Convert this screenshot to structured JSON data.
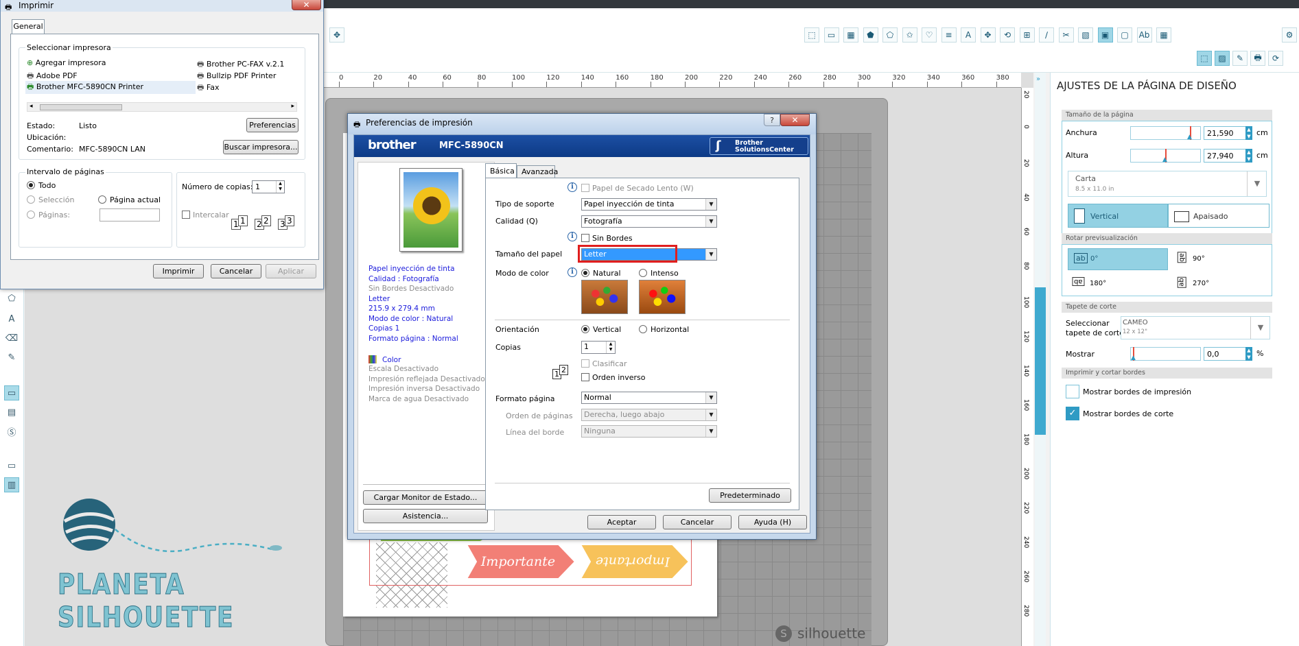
{
  "app": {
    "tool_icons": [
      "select-icon",
      "rectangle-icon",
      "grid-icon",
      "pentagon-icon",
      "star-icon",
      "shape-icon",
      "heart-icon",
      "lines-icon",
      "text-icon",
      "replicate-icon",
      "rotate-icon",
      "scale-icon",
      "knife-icon",
      "trace-icon",
      "page-icon",
      "cut-settings-icon",
      "layout-icon",
      "text-style-icon",
      "grid-settings-icon"
    ],
    "panel": {
      "title": "AJUSTES DE LA PÁGINA DE DISEÑO",
      "size_header": "Tamaño de la página",
      "width_label": "Anchura",
      "width_value": "21,590",
      "height_label": "Altura",
      "height_value": "27,940",
      "unit": "cm",
      "paper_name": "Carta",
      "paper_size": "8.5 x 11.0 in",
      "portrait": "Vertical",
      "landscape": "Apaisado",
      "rotate_header": "Rotar previsualización",
      "rot0": "0°",
      "rot90": "90°",
      "rot180": "180°",
      "rot270": "270°",
      "mat_header": "Tapete de corte",
      "mat_label_1": "Seleccionar",
      "mat_label_2": "tapete de corte",
      "mat_name": "CAMEO",
      "mat_size": "12 x 12\"",
      "show_label": "Mostrar",
      "show_value": "0,0",
      "show_unit": "%",
      "borders_header": "Imprimir y cortar bordes",
      "print_borders": "Mostrar bordes de impresión",
      "cut_borders": "Mostrar bordes de corte"
    },
    "ruler_top": [
      "0",
      "20",
      "40",
      "60",
      "80",
      "100",
      "120",
      "140",
      "160",
      "180",
      "200",
      "220",
      "240",
      "260",
      "280",
      "300",
      "320",
      "340",
      "360",
      "380"
    ],
    "ruler_right": [
      "20",
      "0",
      "20",
      "40",
      "60",
      "80",
      "100",
      "120",
      "140",
      "160",
      "180",
      "200",
      "220",
      "240",
      "260",
      "280"
    ],
    "brand": "silhouette",
    "logo_text": "PLANETA SILHOUETTE",
    "label_1": "Importante",
    "label_2": "Importante"
  },
  "print_dialog": {
    "title": "Imprimir",
    "tab": "General",
    "select_printer": "Seleccionar impresora",
    "printers": [
      "Agregar impresora",
      "Adobe PDF",
      "Brother MFC-5890CN Printer",
      "Brother PC-FAX v.2.1",
      "Bullzip PDF Printer",
      "Fax"
    ],
    "status_label": "Estado:",
    "status_value": "Listo",
    "location_label": "Ubicación:",
    "comment_label": "Comentario:",
    "comment_value": "MFC-5890CN LAN",
    "preferences_btn": "Preferencias",
    "find_printer_btn": "Buscar impresora...",
    "range_title": "Intervalo de páginas",
    "all": "Todo",
    "selection": "Selección",
    "current_page": "Página actual",
    "pages": "Páginas:",
    "copies_label": "Número de copias:",
    "copies_value": "1",
    "collate": "Intercalar",
    "print_btn": "Imprimir",
    "cancel_btn": "Cancelar",
    "apply_btn": "Aplicar"
  },
  "prefs_dialog": {
    "title": "Preferencias de impresión",
    "brand": "brother",
    "model": "MFC-5890CN",
    "solutions_1": "Brother",
    "solutions_2": "SolutionsCenter",
    "tab_basic": "Básica",
    "tab_advanced": "Avanzada",
    "slow_drying": "Papel de Secado Lento (W)",
    "media_type_label": "Tipo de soporte",
    "media_type_value": "Papel inyección de tinta",
    "quality_label": "Calidad (Q)",
    "quality_value": "Fotografía",
    "borderless": "Sin Bordes",
    "paper_size_label": "Tamaño del papel",
    "paper_size_value": "Letter",
    "color_mode_label": "Modo de color",
    "natural": "Natural",
    "vivid": "Intenso",
    "orientation_label": "Orientación",
    "portrait": "Vertical",
    "landscape": "Horizontal",
    "copies_label": "Copias",
    "copies_value": "1",
    "collate": "Clasificar",
    "reverse": "Orden inverso",
    "page_layout_label": "Formato página",
    "page_layout_value": "Normal",
    "page_order_label": "Orden de páginas",
    "page_order_value": "Derecha, luego abajo",
    "border_line_label": "Línea del borde",
    "border_line_value": "Ninguna",
    "default_btn": "Predeterminado",
    "info_lines": [
      "Papel inyección de tinta",
      "Calidad  : Fotografía",
      "Sin Bordes Desactivado",
      "Letter",
      "215.9 x 279.4 mm",
      "Modo de color : Natural",
      "Copias 1",
      "Formato página : Normal"
    ],
    "color_label": "Color",
    "info_lines_2": [
      "Escala Desactivado",
      "Impresión reflejada Desactivado",
      "Impresión inversa Desactivado",
      "Marca de agua Desactivado"
    ],
    "status_monitor_btn": "Cargar Monitor de Estado...",
    "support_btn": "Asistencia...",
    "ok_btn": "Aceptar",
    "cancel_btn": "Cancelar",
    "help_btn": "Ayuda (H)"
  }
}
